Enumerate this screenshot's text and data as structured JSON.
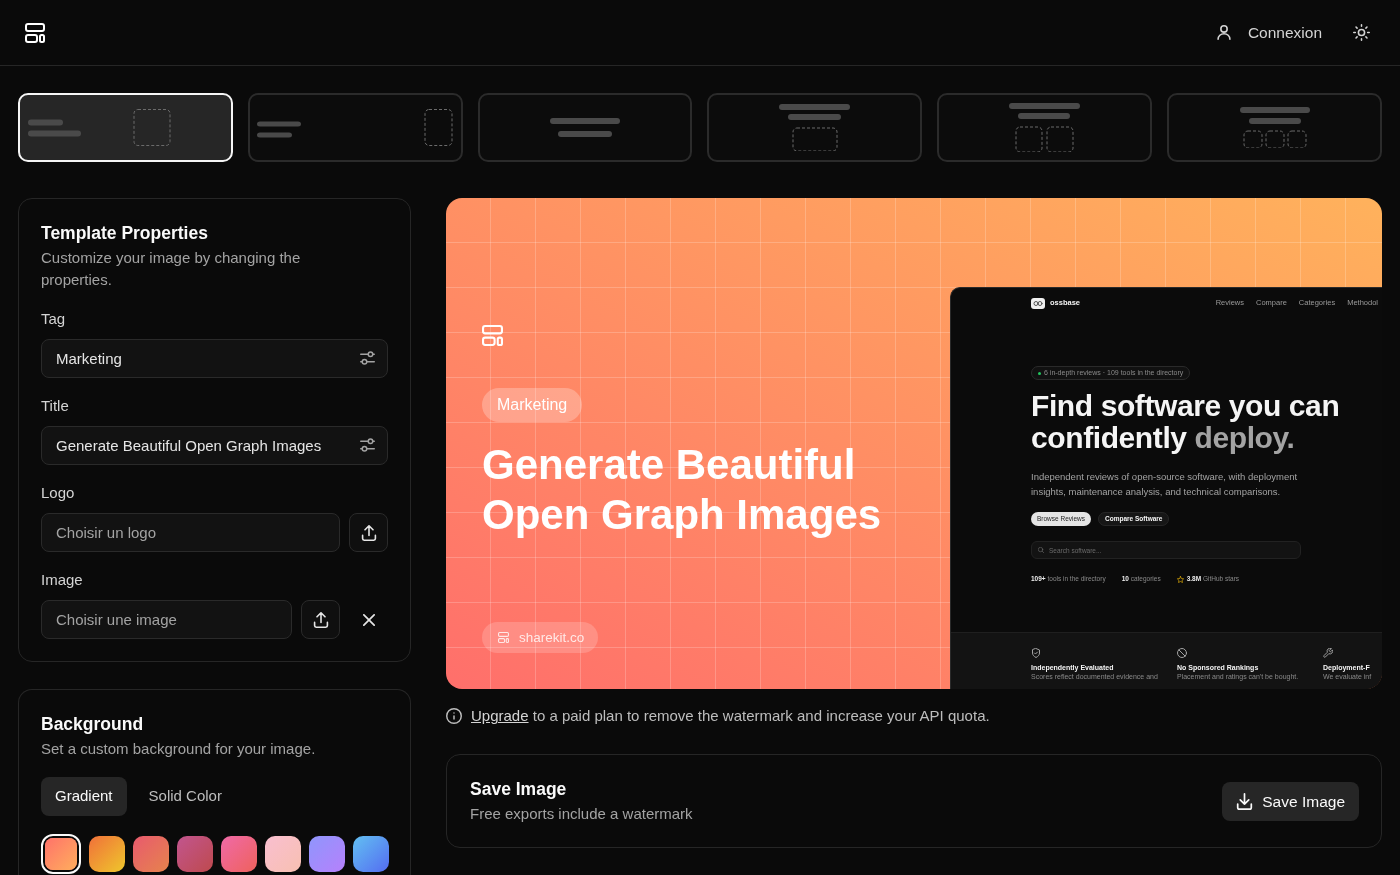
{
  "header": {
    "account_label": "Connexion"
  },
  "templates": [
    {
      "kind": "split",
      "selected": true
    },
    {
      "kind": "sidebar",
      "selected": false
    },
    {
      "kind": "plain",
      "selected": false
    },
    {
      "kind": "banner",
      "selected": false
    },
    {
      "kind": "pair",
      "selected": false
    },
    {
      "kind": "trio",
      "selected": false
    }
  ],
  "properties": {
    "title": "Template Properties",
    "description": "Customize your image by changing the properties.",
    "fields": [
      {
        "kind": "text",
        "label": "Tag",
        "value": "Marketing"
      },
      {
        "kind": "text",
        "label": "Title",
        "value": "Generate Beautiful Open Graph Images"
      },
      {
        "kind": "file",
        "label": "Logo",
        "placeholder": "Choisir un logo",
        "clearable": false
      },
      {
        "kind": "file",
        "label": "Image",
        "placeholder": "Choisir une image",
        "clearable": true
      }
    ]
  },
  "background": {
    "title": "Background",
    "description": "Set a custom background for your image.",
    "modes": [
      {
        "label": "Gradient",
        "selected": true
      },
      {
        "label": "Solid Color",
        "selected": false
      }
    ],
    "swatches": [
      {
        "color": "#ff6f6b",
        "selected": true
      },
      {
        "color": "#f0703a",
        "selected": false
      },
      {
        "color": "#e85a6e",
        "selected": false
      },
      {
        "color": "#c2558f",
        "selected": false
      },
      {
        "color": "#f06aa8",
        "selected": false
      },
      {
        "color": "#f9bfd0",
        "selected": false
      },
      {
        "color": "#8f96fc",
        "selected": false
      },
      {
        "color": "#62c0f2",
        "selected": false
      }
    ]
  },
  "preview": {
    "tag": "Marketing",
    "title": "Generate Beautiful Open Graph Images",
    "site": "sharekit.co",
    "screenshot": {
      "brand": "ossbase",
      "nav": [
        "Reviews",
        "Compare",
        "Categories",
        "Methodol"
      ],
      "announcement": "6 in-depth reviews · 109 tools in the directory",
      "heading": [
        {
          "text": "Find software you can confidently",
          "muted": false
        },
        {
          "text": "deploy.",
          "muted": true
        }
      ],
      "description": "Independent reviews of open-source software, with deployment insights, maintenance analysis, and technical comparisons.",
      "buttons": [
        {
          "label": "Browse Reviews",
          "primary": true
        },
        {
          "label": "Compare Software",
          "primary": false
        }
      ],
      "search_placeholder": "Search software...",
      "stats": [
        {
          "kind": "plain",
          "text": "**109+** tools in the directory"
        },
        {
          "kind": "plain",
          "text": "**10** categories"
        },
        {
          "kind": "star",
          "text": "**3.8M** GitHub stars"
        }
      ],
      "features": [
        {
          "kind": "shield",
          "title": "Independently Evaluated",
          "text": "Scores reflect documented evidence and"
        },
        {
          "kind": "ban",
          "title": "No Sponsored Rankings",
          "text": "Placement and ratings can't be bought."
        },
        {
          "kind": "wrench",
          "title": "Deployment-F",
          "text": "We evaluate inf"
        }
      ]
    }
  },
  "notice": {
    "link": "Upgrade",
    "text": "to a paid plan to remove the watermark and increase your API quota."
  },
  "save": {
    "title": "Save Image",
    "description": "Free exports include a watermark",
    "button": "Save Image"
  }
}
